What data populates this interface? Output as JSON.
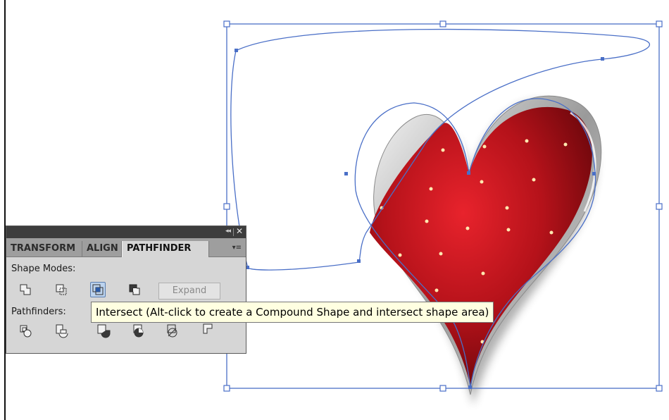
{
  "panel": {
    "collapse_glyph": "◂◂",
    "close_glyph": "✕",
    "tabs": [
      {
        "label": "TRANSFORM"
      },
      {
        "label": "ALIGN"
      },
      {
        "label": "PATHFINDER"
      }
    ],
    "menu_glyph": "▾≡",
    "active_tab": "PATHFINDER",
    "shape_modes_label": "Shape Modes:",
    "pathfinders_label": "Pathfinders:",
    "expand_label": "Expand",
    "shape_mode_icons": [
      "unite-icon",
      "minus-front-icon",
      "intersect-icon",
      "exclude-icon"
    ],
    "pathfinder_icons": [
      "divide-icon",
      "trim-icon",
      "merge-icon",
      "crop-icon",
      "outline-icon",
      "minus-back-icon"
    ]
  },
  "tooltip": {
    "text": "Intersect (Alt-click to create a Compound Shape and intersect shape area)"
  },
  "colors": {
    "path_blue": "#4a6fc7",
    "heart_red": "#c0121a",
    "panel_bg": "#d6d6d6",
    "tooltip_bg": "#ffffe1"
  }
}
